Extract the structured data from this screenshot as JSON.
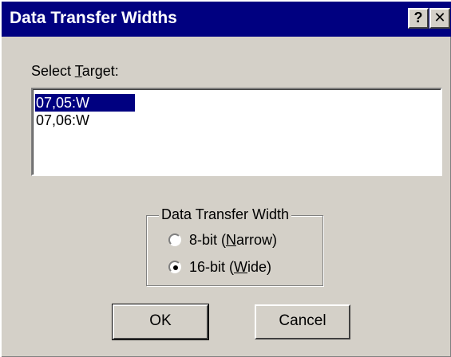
{
  "window": {
    "title": "Data Transfer Widths",
    "help_glyph": "?",
    "close_glyph": "✕"
  },
  "select_target": {
    "label_prefix": "Select ",
    "label_accel": "T",
    "label_suffix": "arget:",
    "items": [
      "07,05:W",
      "07,06:W"
    ],
    "selected_index": 0
  },
  "transfer_width": {
    "legend": "Data Transfer Width",
    "options": [
      {
        "prefix": "8-bit (",
        "accel": "N",
        "suffix": "arrow)"
      },
      {
        "prefix": "16-bit (",
        "accel": "W",
        "suffix": "ide)"
      }
    ],
    "selected_index": 1
  },
  "buttons": {
    "ok": "OK",
    "cancel": "Cancel"
  },
  "colors": {
    "titlebar": "#000080",
    "face": "#d4d0c8",
    "selection": "#000080"
  }
}
